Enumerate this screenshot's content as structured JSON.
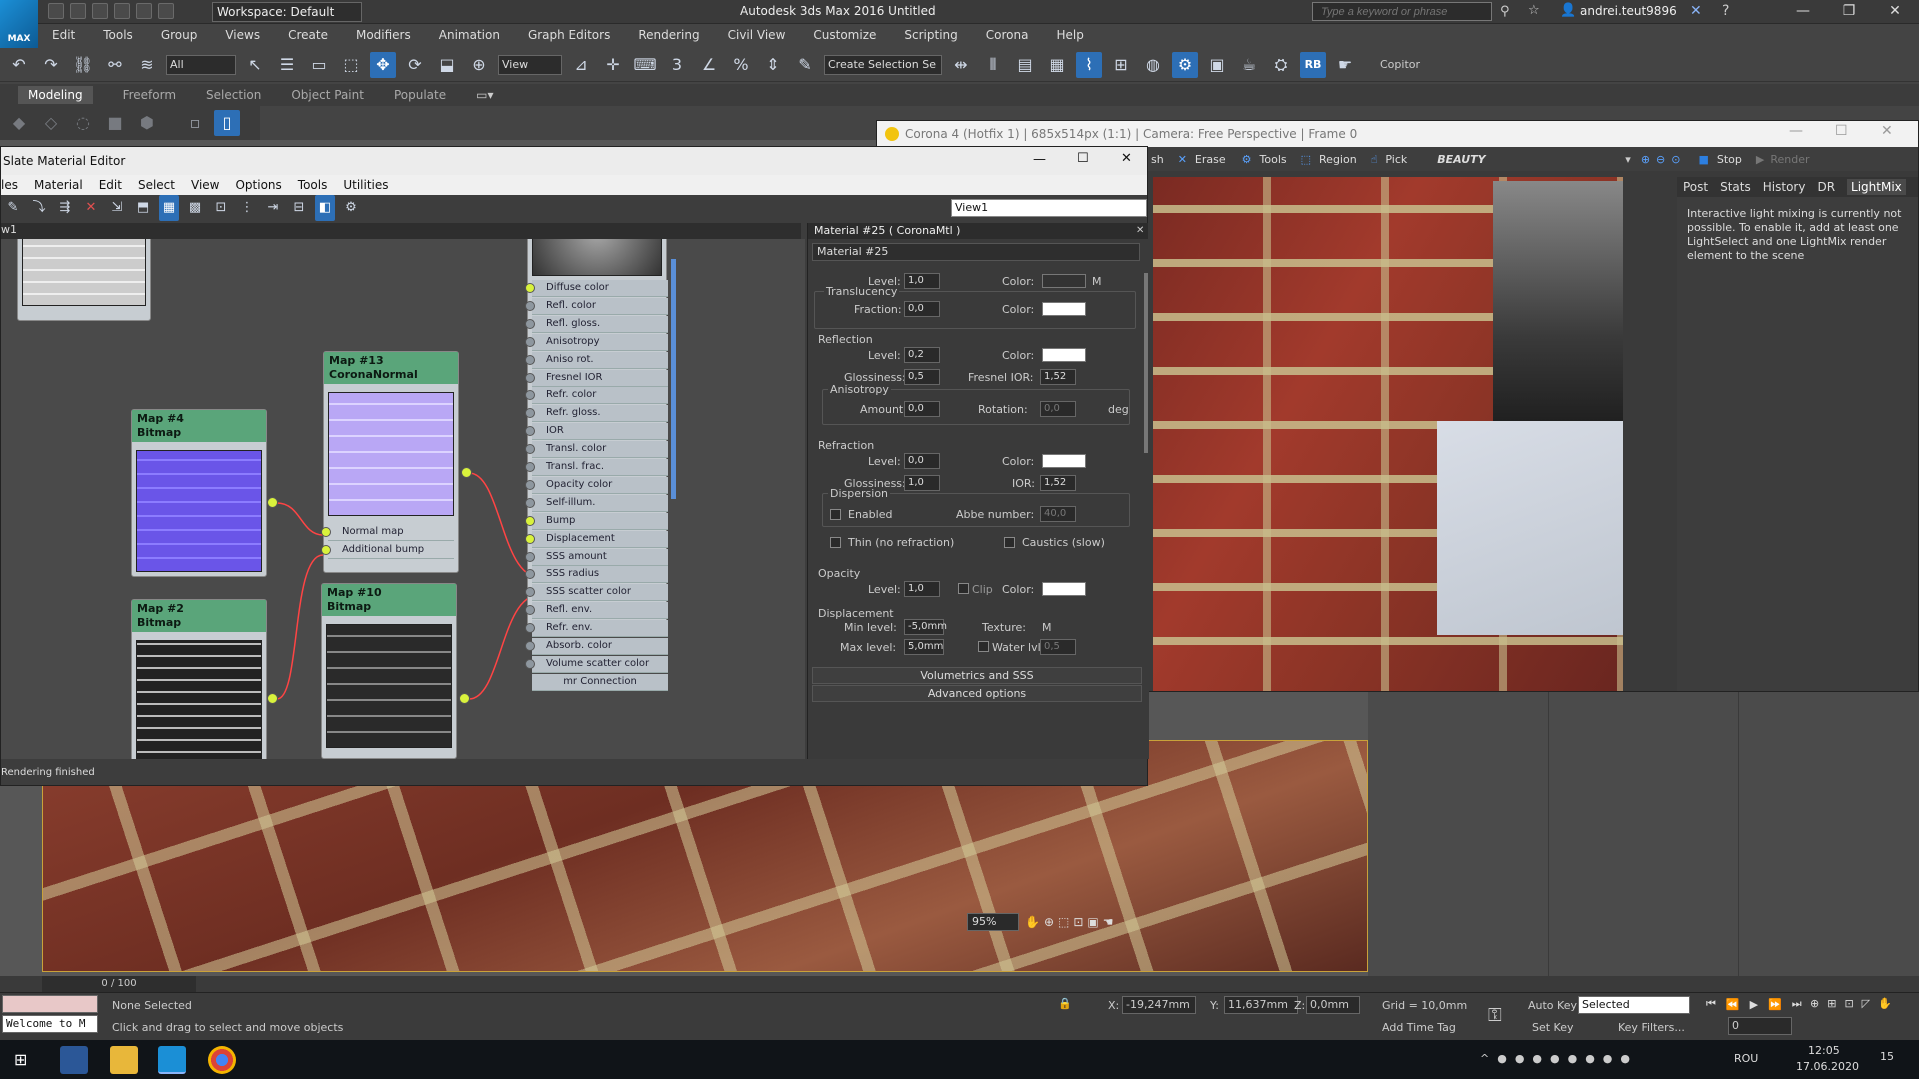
{
  "app": {
    "logo": "MAX",
    "workspace": "Workspace: Default",
    "title": "Autodesk 3ds Max 2016    Untitled",
    "search_placeholder": "Type a keyword or phrase",
    "user": "andrei.teut9896"
  },
  "menu": [
    "Edit",
    "Tools",
    "Group",
    "Views",
    "Create",
    "Modifiers",
    "Animation",
    "Graph Editors",
    "Rendering",
    "Civil View",
    "Customize",
    "Scripting",
    "Corona",
    "Help"
  ],
  "toolbar": {
    "filter": "All",
    "view": "View",
    "selection_set": "Create Selection Se",
    "copitor": "Copitor",
    "rb": "RB"
  },
  "ribbon": [
    "Modeling",
    "Freeform",
    "Selection",
    "Object Paint",
    "Populate"
  ],
  "slate": {
    "title": "Slate Material Editor",
    "menu": [
      "les",
      "Material",
      "Edit",
      "Select",
      "View",
      "Options",
      "Tools",
      "Utilities"
    ],
    "view_select": "View1",
    "tab": "w1",
    "status": "Rendering finished",
    "zoom": "95%",
    "nodes": [
      {
        "title": "Map #13",
        "subtitle": "CoronaNormal",
        "slots": [
          "Normal map",
          "Additional bump"
        ]
      },
      {
        "title": "Map #4",
        "subtitle": "Bitmap"
      },
      {
        "title": "Map #2",
        "subtitle": "Bitmap"
      },
      {
        "title": "Map #10",
        "subtitle": "Bitmap"
      }
    ],
    "material_slots": [
      "Diffuse color",
      "Refl. color",
      "Refl. gloss.",
      "Anisotropy",
      "Aniso rot.",
      "Fresnel IOR",
      "Refr. color",
      "Refr. gloss.",
      "IOR",
      "Transl. color",
      "Transl. frac.",
      "Opacity color",
      "Self-illum.",
      "Bump",
      "Displacement",
      "SSS amount",
      "SSS radius",
      "SSS scatter color",
      "Refl. env.",
      "Refr. env.",
      "Absorb. color",
      "Volume scatter color",
      "mr Connection"
    ],
    "active_slots": [
      "Diffuse color",
      "Bump",
      "Displacement"
    ]
  },
  "params": {
    "header": "Material #25  ( CoronaMtl )",
    "name": "Material #25",
    "diffuse": {
      "level_label": "Level:",
      "level": "1,0",
      "color_label": "Color:",
      "map": "M"
    },
    "translucency": {
      "title": "Translucency",
      "fraction_label": "Fraction:",
      "fraction": "0,0",
      "color_label": "Color:"
    },
    "reflection": {
      "title": "Reflection",
      "level_label": "Level:",
      "level": "0,2",
      "color_label": "Color:",
      "gloss_label": "Glossiness:",
      "gloss": "0,5",
      "fresnel_label": "Fresnel IOR:",
      "fresnel": "1,52"
    },
    "anisotropy": {
      "title": "Anisotropy",
      "amount_label": "Amount:",
      "amount": "0,0",
      "rotation_label": "Rotation:",
      "rotation": "0,0",
      "unit": "deg"
    },
    "refraction": {
      "title": "Refraction",
      "level_label": "Level:",
      "level": "0,0",
      "color_label": "Color:",
      "gloss_label": "Glossiness:",
      "gloss": "1,0",
      "ior_label": "IOR:",
      "ior": "1,52"
    },
    "dispersion": {
      "title": "Dispersion",
      "enabled": "Enabled",
      "abbe_label": "Abbe number:",
      "abbe": "40,0"
    },
    "thin": "Thin (no refraction)",
    "caustics": "Caustics (slow)",
    "opacity": {
      "title": "Opacity",
      "level_label": "Level:",
      "level": "1,0",
      "clip": "Clip",
      "color_label": "Color:"
    },
    "displacement": {
      "title": "Displacement",
      "min_label": "Min level:",
      "min": "-5,0mm",
      "texture_label": "Texture:",
      "map": "M",
      "max_label": "Max level:",
      "max": "5,0mm",
      "water_label": "Water lvl.",
      "water": "0,5"
    },
    "rollouts": [
      "Volumetrics and SSS",
      "Advanced options"
    ]
  },
  "vfb": {
    "title": "Corona 4 (Hotfix 1) | 685x514px (1:1) | Camera: Free Perspective | Frame 0",
    "toolbar": [
      "sh",
      "Erase",
      "Tools",
      "Region",
      "Pick",
      "BEAUTY",
      "Stop",
      "Render"
    ],
    "tabs": [
      "Post",
      "Stats",
      "History",
      "DR",
      "LightMix"
    ],
    "active_tab": "LightMix",
    "lightmix_text": "Interactive light mixing is currently not possible. To enable it, add at least one LightSelect and one LightMix render element to the scene"
  },
  "status": {
    "frame": "0 / 100",
    "selection": "None Selected",
    "prompt": "Click and drag to select and move objects",
    "welcome": "Welcome to M",
    "x_label": "X:",
    "x": "-19,247mm",
    "y_label": "Y:",
    "y": "11,637mm",
    "z_label": "Z:",
    "z": "0,0mm",
    "grid": "Grid = 10,0mm",
    "add_time_tag": "Add Time Tag",
    "auto_key": "Auto Key",
    "set_key": "Set Key",
    "key_mode": "Selected",
    "key_filters": "Key Filters...",
    "current_frame": "0"
  },
  "taskbar": {
    "lang": "ROU",
    "time": "12:05",
    "date": "17.06.2020",
    "notif": "15"
  }
}
